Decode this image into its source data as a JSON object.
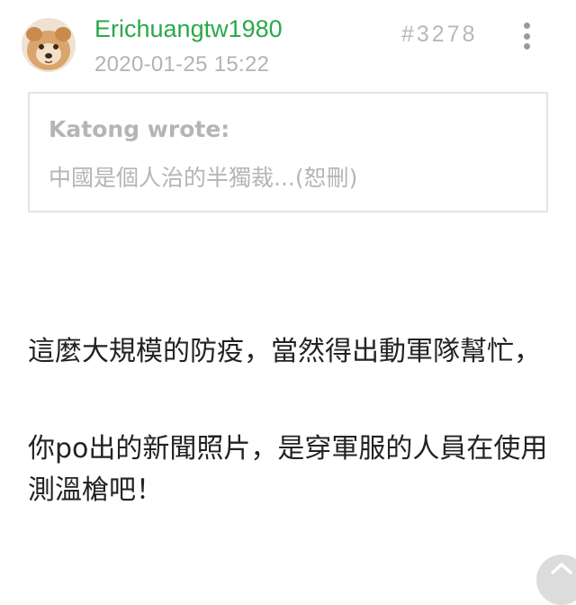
{
  "post": {
    "author": "Erichuangtw1980",
    "timestamp": "2020-01-25 15:22",
    "number": "#3278",
    "quote": {
      "author": "Katong wrote:",
      "text": "中國是個人治的半獨裁...(恕刪)"
    },
    "body": [
      "這麼大規模的防疫，當然得出動軍隊幫忙，",
      "你po出的新聞照片，是穿軍服的人員在使用測溫槍吧！"
    ]
  },
  "colors": {
    "author": "#2aa84a",
    "muted": "#b5b5b5",
    "body_text": "#222222",
    "quote_border": "#e4e4e4"
  },
  "icons": {
    "more": "more-vertical-icon",
    "scroll_top": "chevron-up-icon"
  }
}
